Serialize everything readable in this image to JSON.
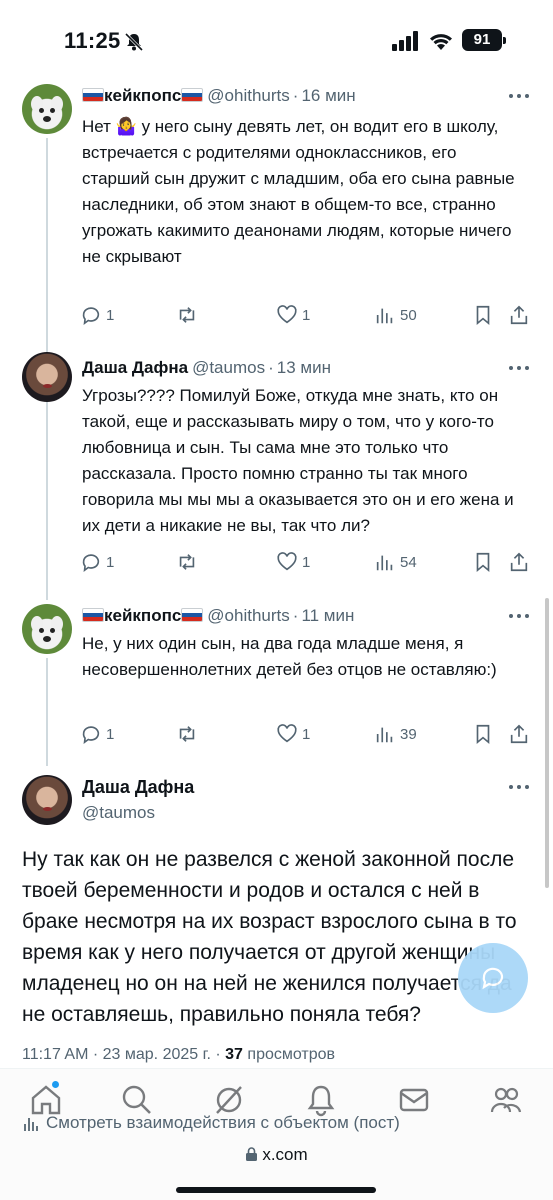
{
  "status_bar": {
    "time": "11:25",
    "battery": "91"
  },
  "tweets": [
    {
      "name": "кейкпопс",
      "handle": "@ohithurts",
      "time": "16 мин",
      "text": "Нет 🤷‍♀️ у него сыну девять лет, он водит его в школу, встречается с родителями одноклассников, его старший сын дружит с младшим, оба его сына равные наследники, об этом знают в общем-то все, странно угрожать какимито деанонами людям, которые ничего не скрывают",
      "replies": "1",
      "likes": "1",
      "views": "50"
    },
    {
      "name": "Даша Дафна",
      "handle": "@taumos",
      "time": "13 мин",
      "text": "Угрозы???? Помилуй Боже, откуда мне знать, кто он такой, еще и рассказывать миру о том, что у кого-то любовница и сын. Ты сама мне это только что рассказала. Просто помню странно ты так много говорила мы мы мы а оказывается это он и его жена и их дети а никакие не вы, так что ли?",
      "replies": "1",
      "likes": "1",
      "views": "54"
    },
    {
      "name": "кейкпопс",
      "handle": "@ohithurts",
      "time": "11 мин",
      "text": "Не, у них один сын, на два года младше меня, я несовершеннолетних детей без отцов не оставляю:)",
      "replies": "1",
      "likes": "1",
      "views": "39"
    }
  ],
  "main_tweet": {
    "name": "Даша Дафна",
    "handle": "@taumos",
    "text": "Ну так как он не развелся с женой законной после твоей беременности и родов и остался с ней в браке несмотря на их возраст взрослого сына в то время как у него получается от другой женщины младенец но он на ней не женился получается да не оставляешь, правильно поняла тебя?",
    "timestamp": "11:17 AM · 23 мар. 2025 г. · ",
    "views_count": "37",
    "views_label": " просмотров"
  },
  "bottom": {
    "view_interactions": "Смотреть взаимодействия с объектом (пост)",
    "url": "x.com"
  },
  "icons": {
    "nav": [
      "home-icon",
      "search-icon",
      "grok-icon",
      "notifications-icon",
      "messages-icon",
      "communities-icon"
    ]
  },
  "colors": {
    "accent": "#1d9bf0",
    "secondary_text": "#536471",
    "text": "#0f1419"
  }
}
